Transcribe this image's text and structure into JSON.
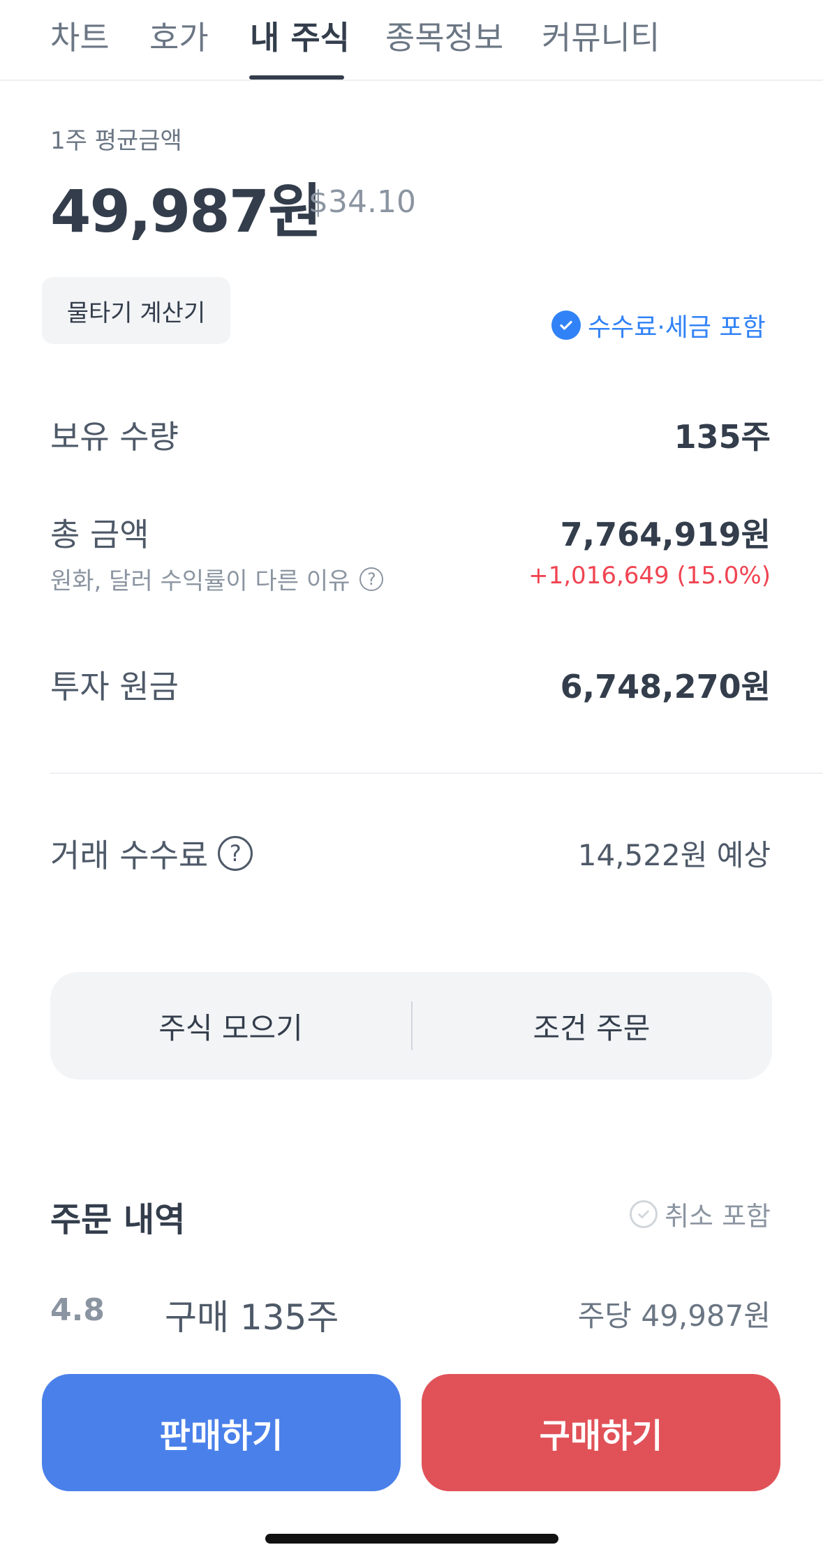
{
  "tabs": [
    "차트",
    "호가",
    "내 주식",
    "종목정보",
    "커뮤니티"
  ],
  "active_tab": "내 주식",
  "summary": {
    "avg_label": "1주 평균금액",
    "avg_price": "49,987원",
    "avg_price_usd": "$34.10"
  },
  "actions": {
    "calculator_label": "물타기 계산기",
    "fee_toggle_label": "수수료·세금 포함"
  },
  "holdings": {
    "quantity_label": "보유 수량",
    "quantity_value": "135주",
    "total_label": "총 금액",
    "total_value": "7,764,919원",
    "total_sub_label": "원화, 달러 수익률이 다른 이유",
    "profit": "+1,016,649 (15.0%)",
    "principal_label": "투자 원금",
    "principal_value": "6,748,270원",
    "fee_label": "거래 수수료",
    "fee_value": "14,522원 예상"
  },
  "segment": {
    "left_label": "주식 모으기",
    "right_label": "조건 주문"
  },
  "orders": {
    "title": "주문 내역",
    "cancel_toggle_label": "취소 포함",
    "items": [
      {
        "date": "4.8",
        "desc": "구매 135주",
        "price": "주당 49,987원"
      }
    ]
  },
  "bottom": {
    "sell_label": "판매하기",
    "buy_label": "구매하기"
  },
  "colors": {
    "accent_blue": "#3182f6",
    "sell_button": "#4a80ea",
    "buy_button": "#e05258",
    "profit_red": "#f04452"
  },
  "icons": {
    "fee_check": "check-circle-filled",
    "question": "question-circle",
    "cancel_check": "check-circle-outline"
  }
}
